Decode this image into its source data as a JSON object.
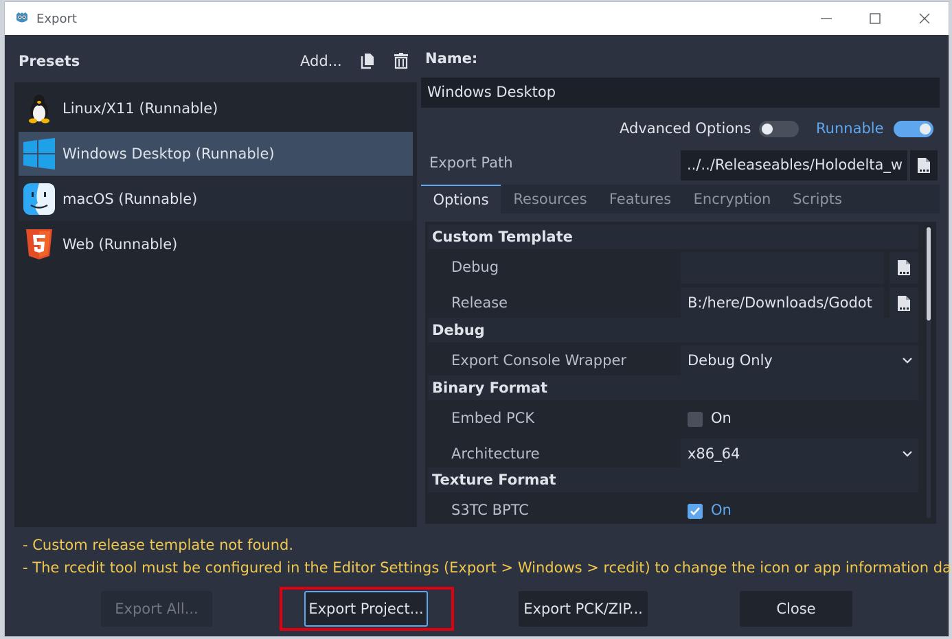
{
  "window": {
    "title": "Export"
  },
  "presets": {
    "heading": "Presets",
    "add_label": "Add...",
    "items": [
      {
        "label": "Linux/X11 (Runnable)",
        "icon": "linux-penguin-icon"
      },
      {
        "label": "Windows Desktop (Runnable)",
        "icon": "windows-logo-icon",
        "selected": true
      },
      {
        "label": "macOS (Runnable)",
        "icon": "macos-finder-icon"
      },
      {
        "label": "Web (Runnable)",
        "icon": "html5-icon"
      }
    ]
  },
  "details": {
    "name_label": "Name:",
    "name_value": "Windows Desktop",
    "advanced_options_label": "Advanced Options",
    "advanced_options_on": false,
    "runnable_label": "Runnable",
    "runnable_on": true,
    "export_path_label": "Export Path",
    "export_path_value": "../../Releaseables/Holodelta_w",
    "tabs": [
      "Options",
      "Resources",
      "Features",
      "Encryption",
      "Scripts"
    ],
    "active_tab": "Options"
  },
  "options": {
    "custom_template": {
      "heading": "Custom Template",
      "debug_label": "Debug",
      "debug_value": "",
      "release_label": "Release",
      "release_value": "B:/here/Downloads/Godot"
    },
    "debug": {
      "heading": "Debug",
      "console_wrapper_label": "Export Console Wrapper",
      "console_wrapper_value": "Debug Only"
    },
    "binary_format": {
      "heading": "Binary Format",
      "embed_pck_label": "Embed PCK",
      "embed_pck_value": "On",
      "embed_pck_checked": false,
      "architecture_label": "Architecture",
      "architecture_value": "x86_64"
    },
    "texture_format": {
      "heading": "Texture Format",
      "s3tc_label": "S3TC BPTC",
      "s3tc_value": "On",
      "s3tc_checked": true
    }
  },
  "warnings": [
    "- Custom release template not found.",
    "- The rcedit tool must be configured in the Editor Settings (Export > Windows > rcedit) to change the icon or app information data."
  ],
  "buttons": {
    "export_all": "Export All...",
    "export_project": "Export Project...",
    "export_pck_zip": "Export PCK/ZIP...",
    "close": "Close"
  },
  "colors": {
    "accent": "#5ea7ee",
    "warning": "#f0c84d",
    "highlight": "#e0000f"
  }
}
